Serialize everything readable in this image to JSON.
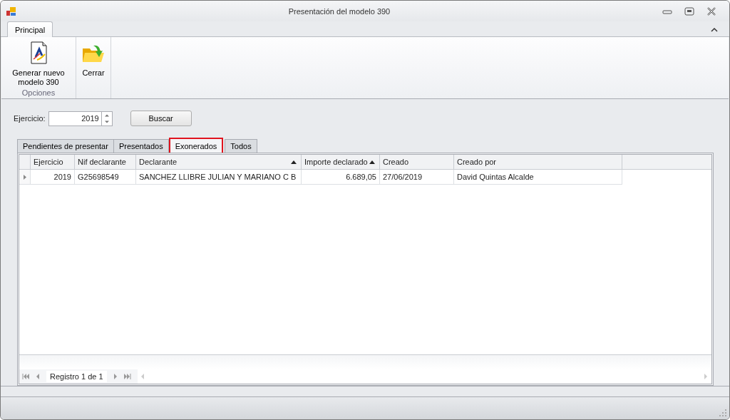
{
  "window": {
    "title": "Presentación del modelo 390"
  },
  "ribbon": {
    "tabs": [
      {
        "label": "Principal",
        "selected": true
      }
    ],
    "groups": [
      {
        "caption": "Opciones",
        "buttons": [
          {
            "label": "Generar nuevo modelo 390",
            "kind": "document"
          }
        ]
      },
      {
        "buttons": [
          {
            "label": "Cerrar",
            "kind": "folder"
          }
        ]
      }
    ]
  },
  "filter": {
    "label": "Ejercicio:",
    "value": "2019",
    "button": "Buscar"
  },
  "tabs": [
    {
      "label": "Pendientes de presentar",
      "selected": false
    },
    {
      "label": "Presentados",
      "selected": false
    },
    {
      "label": "Exonerados",
      "selected": true
    },
    {
      "label": "Todos",
      "selected": false
    }
  ],
  "table": {
    "columns": [
      {
        "label": "Ejercicio",
        "sorted": false
      },
      {
        "label": "Nif declarante",
        "sorted": false
      },
      {
        "label": "Declarante",
        "sorted": true
      },
      {
        "label": "Importe declarado",
        "sorted": true
      },
      {
        "label": "Creado",
        "sorted": false
      },
      {
        "label": "Creado por",
        "sorted": false
      }
    ],
    "rows": [
      {
        "current": true,
        "cells": [
          "2019",
          "G25698549",
          "SANCHEZ LLIBRE JULIAN Y MARIANO C B",
          "6.689,05",
          "27/06/2019",
          "David Quintas Alcalde"
        ]
      }
    ]
  },
  "navigator": {
    "text": "Registro 1 de 1"
  }
}
